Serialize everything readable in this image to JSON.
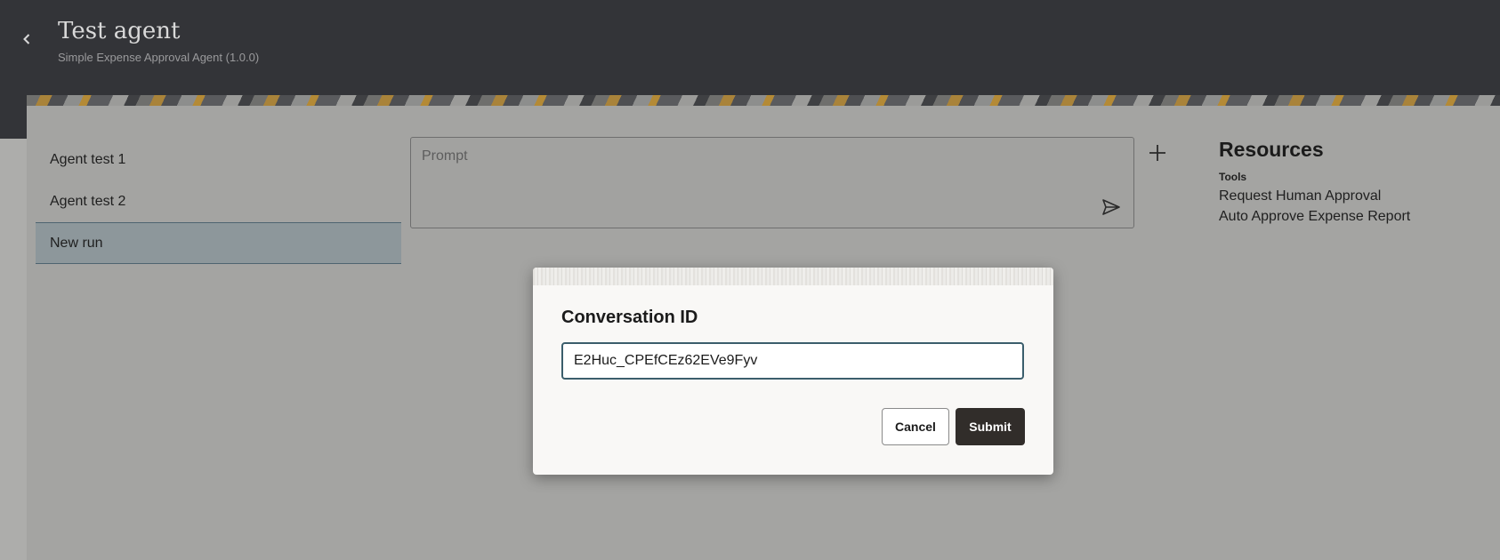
{
  "header": {
    "title": "Test agent",
    "subtitle": "Simple Expense Approval Agent (1.0.0)",
    "back_icon": "chevron-left-icon"
  },
  "runs": {
    "items": [
      {
        "label": "Agent test 1",
        "active": false
      },
      {
        "label": "Agent test 2",
        "active": false
      },
      {
        "label": "New run",
        "active": true
      }
    ]
  },
  "prompt": {
    "placeholder": "Prompt",
    "send_icon": "send-icon",
    "add_icon": "plus-icon"
  },
  "resources": {
    "title": "Resources",
    "section": "Tools",
    "tools": [
      "Request Human Approval",
      "Auto Approve Expense Report"
    ]
  },
  "dialog": {
    "title": "Conversation ID",
    "input_value": "E2Huc_CPEfCEz62EVe9Fyv",
    "cancel_label": "Cancel",
    "submit_label": "Submit"
  },
  "colors": {
    "header_bg": "#333438",
    "overlay_bg": "#a4a4a2",
    "active_run_bg": "#8d979b",
    "submit_bg": "#312d2a",
    "input_border": "#3b5e6c"
  }
}
